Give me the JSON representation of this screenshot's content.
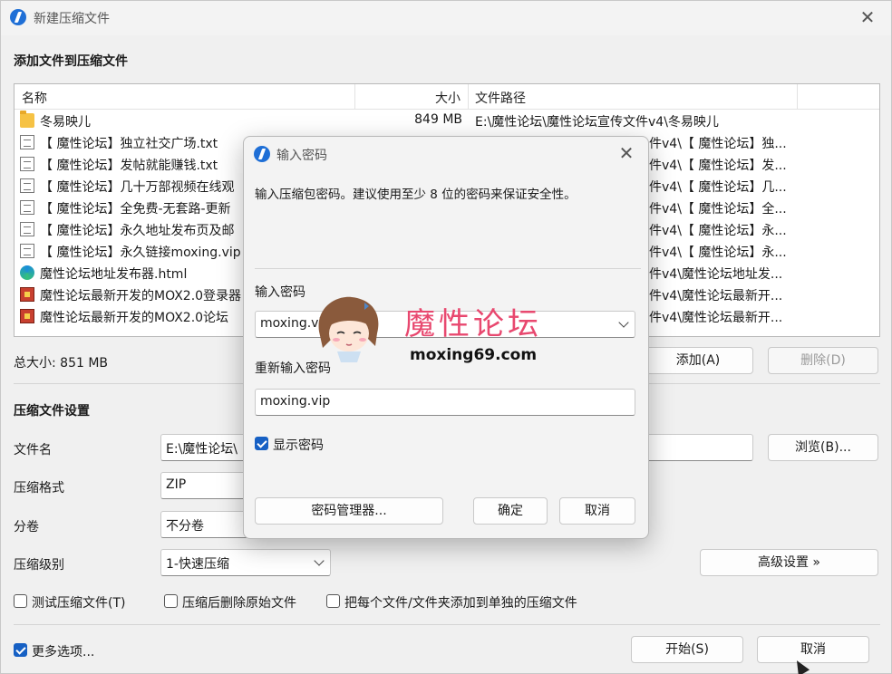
{
  "window": {
    "title": "新建压缩文件"
  },
  "add_section": {
    "heading": "添加文件到压缩文件"
  },
  "file_list": {
    "columns": [
      "名称",
      "大小",
      "文件路径"
    ],
    "rows": [
      {
        "icon": "folder-icon",
        "name": "冬易映儿",
        "size": "849 MB",
        "path": "E:\\魔性论坛\\魔性论坛宣传文件v4\\冬易映儿"
      },
      {
        "icon": "text-file-icon",
        "name": "【 魔性论坛】独立社交广场.txt",
        "size": "",
        "path": "件v4\\【 魔性论坛】独..."
      },
      {
        "icon": "text-file-icon",
        "name": "【 魔性论坛】发帖就能赚钱.txt",
        "size": "",
        "path": "件v4\\【 魔性论坛】发..."
      },
      {
        "icon": "text-file-icon",
        "name": "【 魔性论坛】几十万部视频在线观",
        "size": "",
        "path": "件v4\\【 魔性论坛】几..."
      },
      {
        "icon": "text-file-icon",
        "name": "【 魔性论坛】全免费-无套路-更新",
        "size": "",
        "path": "件v4\\【 魔性论坛】全..."
      },
      {
        "icon": "text-file-icon",
        "name": "【 魔性论坛】永久地址发布页及邮",
        "size": "",
        "path": "件v4\\【 魔性论坛】永..."
      },
      {
        "icon": "text-file-icon",
        "name": "【 魔性论坛】永久链接moxing.vip",
        "size": "",
        "path": "件v4\\【 魔性论坛】永..."
      },
      {
        "icon": "edge-html-icon",
        "name": "魔性论坛地址发布器.html",
        "size": "",
        "path": "件v4\\魔性论坛地址发..."
      },
      {
        "icon": "exe-file-icon",
        "name": "魔性论坛最新开发的MOX2.0登录器",
        "size": "",
        "path": "件v4\\魔性论坛最新开..."
      },
      {
        "icon": "exe-file-icon",
        "name": "魔性论坛最新开发的MOX2.0论坛",
        "size": "",
        "path": "件v4\\魔性论坛最新开..."
      }
    ]
  },
  "total_size": "总大小: 851 MB",
  "buttons": {
    "add": "添加(A)",
    "delete": "删除(D)",
    "browse": "浏览(B)...",
    "advanced": "高级设置 »",
    "start": "开始(S)",
    "cancel": "取消"
  },
  "settings": {
    "heading": "压缩文件设置",
    "filename_label": "文件名",
    "filename_value": "E:\\魔性论坛\\",
    "format_label": "压缩格式",
    "format_value": "ZIP",
    "split_label": "分卷",
    "split_value": "不分卷",
    "level_label": "压缩级别",
    "level_value": "1-快速压缩"
  },
  "options": {
    "test": "测试压缩文件(T)",
    "delete_original": "压缩后删除原始文件",
    "each_separate": "把每个文件/文件夹添加到单独的压缩文件",
    "more_options": "更多选项..."
  },
  "password_dialog": {
    "title": "输入密码",
    "description": "输入压缩包密码。建议使用至少 8 位的密码来保证安全性。",
    "password_label": "输入密码",
    "password_value": "moxing.vi",
    "reenter_label": "重新输入密码",
    "reenter_value": "moxing.vip",
    "show_password": "显示密码",
    "manager_button": "密码管理器...",
    "ok_button": "确定",
    "cancel_button": "取消"
  },
  "watermark": {
    "text": "魔性论坛",
    "url": "moxing69.com"
  },
  "colors": {
    "accent": "#1660c4",
    "watermark_pink": "#e8486f"
  }
}
